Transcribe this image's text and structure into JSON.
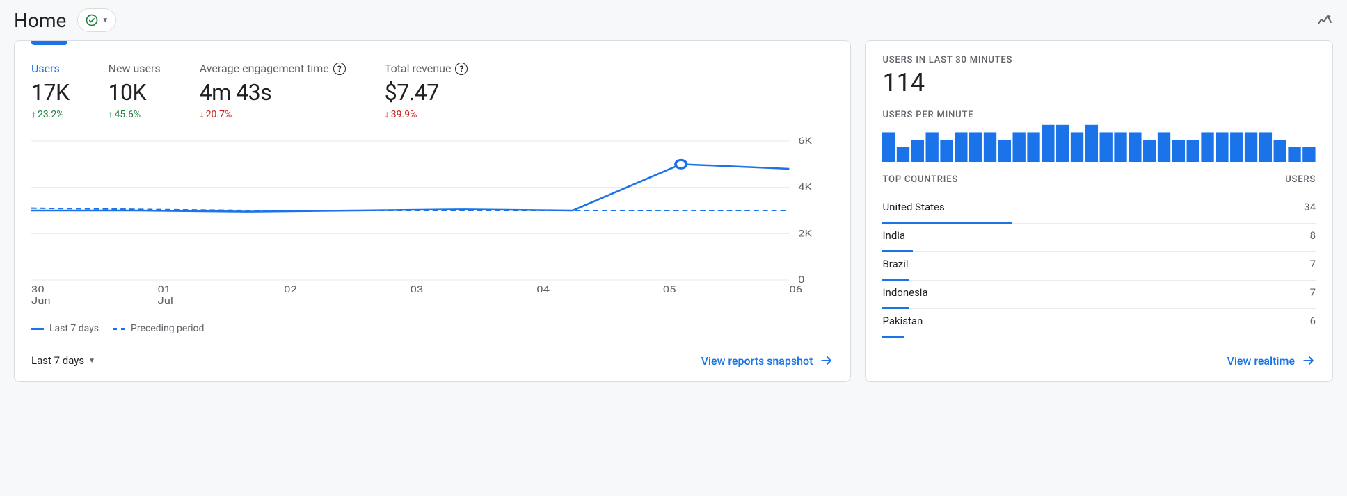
{
  "header": {
    "title": "Home"
  },
  "metrics": [
    {
      "label": "Users",
      "value": "17K",
      "change": "23.2%",
      "dir": "up",
      "active": true,
      "help": false
    },
    {
      "label": "New users",
      "value": "10K",
      "change": "45.6%",
      "dir": "up",
      "active": false,
      "help": false
    },
    {
      "label": "Average engagement time",
      "value": "4m 43s",
      "change": "20.7%",
      "dir": "down",
      "active": false,
      "help": true
    },
    {
      "label": "Total revenue",
      "value": "$7.47",
      "change": "39.9%",
      "dir": "down",
      "active": false,
      "help": true
    }
  ],
  "chart_data": {
    "type": "line",
    "x_labels": [
      "30",
      "01",
      "02",
      "03",
      "04",
      "05",
      "06"
    ],
    "x_sub_labels": [
      "Jun",
      "Jul",
      "",
      "",
      "",
      "",
      ""
    ],
    "ylim": [
      0,
      6000
    ],
    "y_ticks": [
      0,
      2000,
      4000,
      6000
    ],
    "y_tick_labels": [
      "0",
      "2K",
      "4K",
      "6K"
    ],
    "series": [
      {
        "name": "Last 7 days",
        "style": "solid",
        "values": [
          3000,
          3000,
          2950,
          3000,
          3050,
          3000,
          5000,
          4800
        ],
        "marker_index": 6
      },
      {
        "name": "Preceding period",
        "style": "dashed",
        "values": [
          3100,
          3050,
          3000,
          3000,
          3000,
          3000,
          3000,
          3000
        ]
      }
    ]
  },
  "legend": {
    "solid": "Last 7 days",
    "dashed": "Preceding period"
  },
  "footer": {
    "range": "Last 7 days",
    "link": "View reports snapshot"
  },
  "realtime": {
    "label_users_30": "USERS IN LAST 30 MINUTES",
    "users_30": "114",
    "label_per_min": "USERS PER MINUTE",
    "spark": [
      4,
      2,
      3,
      4,
      3,
      4,
      4,
      4,
      3,
      4,
      4,
      5,
      5,
      4,
      5,
      4,
      4,
      4,
      3,
      4,
      3,
      3,
      4,
      4,
      4,
      4,
      4,
      3,
      2,
      2
    ],
    "col_countries": "TOP COUNTRIES",
    "col_users": "USERS",
    "countries": [
      {
        "name": "United States",
        "value": "34",
        "bar": 30
      },
      {
        "name": "India",
        "value": "8",
        "bar": 7
      },
      {
        "name": "Brazil",
        "value": "7",
        "bar": 6
      },
      {
        "name": "Indonesia",
        "value": "7",
        "bar": 6
      },
      {
        "name": "Pakistan",
        "value": "6",
        "bar": 5
      }
    ],
    "link": "View realtime"
  }
}
